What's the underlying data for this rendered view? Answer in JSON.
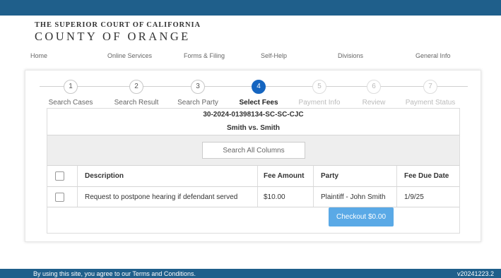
{
  "logo": {
    "line1": "THE SUPERIOR COURT OF CALIFORNIA",
    "line2": "COUNTY OF ORANGE"
  },
  "nav": {
    "items": [
      "Home",
      "Online Services",
      "Forms & Filing",
      "Self-Help",
      "Divisions",
      "General Info"
    ]
  },
  "steps": [
    {
      "number": "1",
      "label": "Search Cases",
      "state": "done"
    },
    {
      "number": "2",
      "label": "Search Result",
      "state": "done"
    },
    {
      "number": "3",
      "label": "Search Party",
      "state": "done"
    },
    {
      "number": "4",
      "label": "Select Fees",
      "state": "active"
    },
    {
      "number": "5",
      "label": "Payment Info",
      "state": "future"
    },
    {
      "number": "6",
      "label": "Review",
      "state": "future"
    },
    {
      "number": "7",
      "label": "Payment Status",
      "state": "future"
    }
  ],
  "case": {
    "number": "30-2024-01398134-SC-SC-CJC",
    "title": "Smith vs. Smith"
  },
  "search": {
    "placeholder": "Search All Columns",
    "value": ""
  },
  "table": {
    "columns": [
      "Description",
      "Fee Amount",
      "Party",
      "Fee Due Date"
    ],
    "rows": [
      {
        "checked": false,
        "description": "Request to postpone hearing if defendant served",
        "fee_amount": "$10.00",
        "party": "Plaintiff - John Smith",
        "due_date": "1/9/25"
      }
    ]
  },
  "checkout": {
    "label": "Checkout $0.00"
  },
  "footer": {
    "text": "By using this site, you agree to our Terms and Conditions.",
    "version": "v20241223.2"
  },
  "colors": {
    "brand_bar": "#1f5f8b",
    "active_step": "#1565c0",
    "checkout_button": "#5aa9e6"
  }
}
